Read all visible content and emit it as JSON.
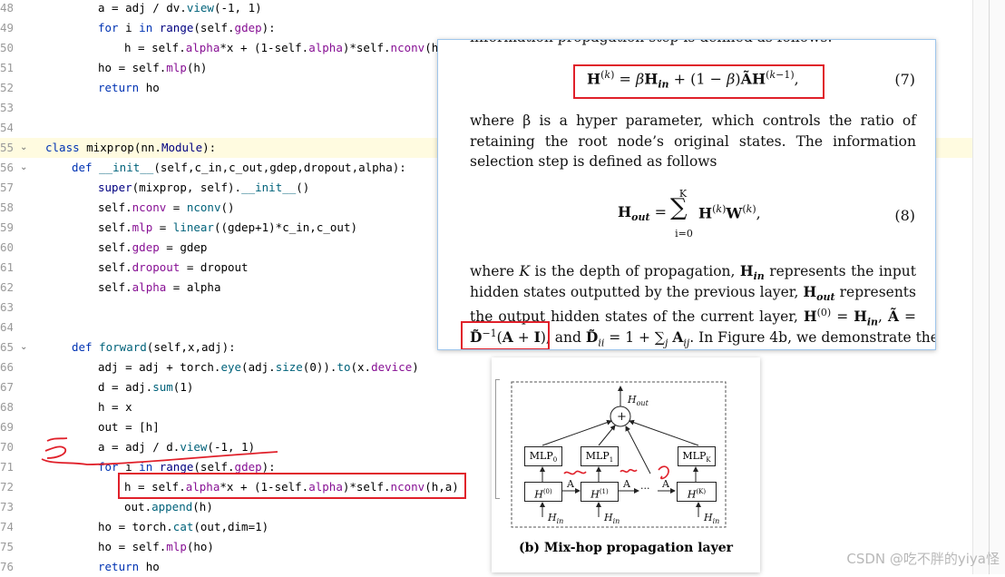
{
  "editor": {
    "lines": [
      {
        "num": "48",
        "fold": "",
        "indent": 108,
        "segs": [
          [
            "a = adj / dv.",
            ""
          ],
          [
            "view",
            "fn"
          ],
          [
            "(-1, 1)",
            ""
          ]
        ]
      },
      {
        "num": "49",
        "fold": "",
        "indent": 108,
        "segs": [
          [
            "for ",
            "kw"
          ],
          [
            "i ",
            ""
          ],
          [
            "in ",
            "kw"
          ],
          [
            "range",
            "bi"
          ],
          [
            "(self.",
            ""
          ],
          [
            "gdep",
            "at"
          ],
          [
            "):",
            ""
          ]
        ]
      },
      {
        "num": "50",
        "fold": "",
        "indent": 137,
        "segs": [
          [
            "h = self.",
            ""
          ],
          [
            "alpha",
            "at"
          ],
          [
            "*x + (1-self.",
            ""
          ],
          [
            "alpha",
            "at"
          ],
          [
            ")*self.",
            ""
          ],
          [
            "nconv",
            "at"
          ],
          [
            "(h,a",
            ""
          ]
        ]
      },
      {
        "num": "51",
        "fold": "",
        "indent": 108,
        "segs": [
          [
            "ho = self.",
            ""
          ],
          [
            "mlp",
            "at"
          ],
          [
            "(h)",
            ""
          ]
        ]
      },
      {
        "num": "52",
        "fold": "",
        "indent": 108,
        "segs": [
          [
            "return ",
            "kw"
          ],
          [
            "ho",
            ""
          ]
        ]
      },
      {
        "num": "53",
        "fold": "",
        "indent": 0,
        "segs": []
      },
      {
        "num": "54",
        "fold": "",
        "indent": 0,
        "segs": []
      },
      {
        "num": "55",
        "fold": "v",
        "indent": 50,
        "hl": true,
        "segs": [
          [
            "class ",
            "kw"
          ],
          [
            "mixprop(nn.",
            ""
          ],
          [
            "Module",
            "bi"
          ],
          [
            "):",
            ""
          ]
        ]
      },
      {
        "num": "56",
        "fold": "v",
        "indent": 79,
        "segs": [
          [
            "def ",
            "kw"
          ],
          [
            "__init__",
            "fn"
          ],
          [
            "(self,c_in,c_out,gdep,dropout,alpha):",
            ""
          ]
        ]
      },
      {
        "num": "57",
        "fold": "",
        "indent": 108,
        "segs": [
          [
            "super",
            "bi"
          ],
          [
            "(mixprop, self).",
            ""
          ],
          [
            "__init__",
            "fn"
          ],
          [
            "()",
            ""
          ]
        ]
      },
      {
        "num": "58",
        "fold": "",
        "indent": 108,
        "segs": [
          [
            "self.",
            ""
          ],
          [
            "nconv",
            "at"
          ],
          [
            " = ",
            ""
          ],
          [
            "nconv",
            "fn"
          ],
          [
            "()",
            ""
          ]
        ]
      },
      {
        "num": "59",
        "fold": "",
        "indent": 108,
        "segs": [
          [
            "self.",
            ""
          ],
          [
            "mlp",
            "at"
          ],
          [
            " = ",
            ""
          ],
          [
            "linear",
            "fn"
          ],
          [
            "((gdep+1)*c_in,c_out)",
            ""
          ]
        ]
      },
      {
        "num": "60",
        "fold": "",
        "indent": 108,
        "segs": [
          [
            "self.",
            ""
          ],
          [
            "gdep",
            "at"
          ],
          [
            " = gdep",
            ""
          ]
        ]
      },
      {
        "num": "61",
        "fold": "",
        "indent": 108,
        "segs": [
          [
            "self.",
            ""
          ],
          [
            "dropout",
            "at"
          ],
          [
            " = dropout",
            ""
          ]
        ]
      },
      {
        "num": "62",
        "fold": "",
        "indent": 108,
        "segs": [
          [
            "self.",
            ""
          ],
          [
            "alpha",
            "at"
          ],
          [
            " = alpha",
            ""
          ]
        ]
      },
      {
        "num": "63",
        "fold": "",
        "indent": 0,
        "segs": []
      },
      {
        "num": "64",
        "fold": "",
        "indent": 0,
        "segs": []
      },
      {
        "num": "65",
        "fold": "v",
        "indent": 79,
        "segs": [
          [
            "def ",
            "kw"
          ],
          [
            "forward",
            "fn"
          ],
          [
            "(self,x,adj):",
            ""
          ]
        ]
      },
      {
        "num": "66",
        "fold": "",
        "indent": 108,
        "segs": [
          [
            "adj = adj + torch.",
            ""
          ],
          [
            "eye",
            "fn"
          ],
          [
            "(adj.",
            ""
          ],
          [
            "size",
            "fn"
          ],
          [
            "(0)).",
            ""
          ],
          [
            "to",
            "fn"
          ],
          [
            "(x.",
            ""
          ],
          [
            "device",
            "at"
          ],
          [
            ")",
            ""
          ]
        ]
      },
      {
        "num": "67",
        "fold": "",
        "indent": 108,
        "segs": [
          [
            "d = adj.",
            ""
          ],
          [
            "sum",
            "fn"
          ],
          [
            "(1)",
            ""
          ]
        ]
      },
      {
        "num": "68",
        "fold": "",
        "indent": 108,
        "segs": [
          [
            "h = x",
            ""
          ]
        ]
      },
      {
        "num": "69",
        "fold": "",
        "indent": 108,
        "segs": [
          [
            "out = [h]",
            ""
          ]
        ]
      },
      {
        "num": "70",
        "fold": "",
        "indent": 108,
        "segs": [
          [
            "a = adj / d.",
            ""
          ],
          [
            "view",
            "fn"
          ],
          [
            "(-1, 1)",
            ""
          ]
        ]
      },
      {
        "num": "71",
        "fold": "",
        "indent": 108,
        "segs": [
          [
            "for ",
            "kw"
          ],
          [
            "i ",
            ""
          ],
          [
            "in ",
            "kw"
          ],
          [
            "range",
            "bi"
          ],
          [
            "(self.",
            ""
          ],
          [
            "gdep",
            "at"
          ],
          [
            "):",
            ""
          ]
        ]
      },
      {
        "num": "72",
        "fold": "",
        "indent": 137,
        "segs": [
          [
            "h = self.",
            ""
          ],
          [
            "alpha",
            "at"
          ],
          [
            "*x + (1-self.",
            ""
          ],
          [
            "alpha",
            "at"
          ],
          [
            ")*self.",
            ""
          ],
          [
            "nconv",
            "at"
          ],
          [
            "(h,a)",
            ""
          ]
        ]
      },
      {
        "num": "73",
        "fold": "",
        "indent": 137,
        "segs": [
          [
            "out.",
            ""
          ],
          [
            "append",
            "fn"
          ],
          [
            "(h)",
            ""
          ]
        ]
      },
      {
        "num": "74",
        "fold": "",
        "indent": 108,
        "segs": [
          [
            "ho = torch.",
            ""
          ],
          [
            "cat",
            "fn"
          ],
          [
            "(out,dim=1)",
            ""
          ]
        ]
      },
      {
        "num": "75",
        "fold": "",
        "indent": 108,
        "segs": [
          [
            "ho = self.",
            ""
          ],
          [
            "mlp",
            "at"
          ],
          [
            "(ho)",
            ""
          ]
        ]
      },
      {
        "num": "76",
        "fold": "",
        "indent": 108,
        "segs": [
          [
            "return ",
            "kw"
          ],
          [
            "ho",
            ""
          ]
        ]
      }
    ]
  },
  "paper": {
    "cut_top": "information propagation step is defined as follows:",
    "eq7": "H(k) = βHin + (1 − β)ÃH(k−1),",
    "eq7_no": "(7)",
    "para1": "where β is a hyper parameter, which controls the ratio of retaining the root node’s original states. The information selection step is defined as follows",
    "eq8_lhs": "Hout =",
    "eq8_sum_top": "K",
    "eq8_sum_bottom": "i=0",
    "eq8_rhs": "H(k)W(k),",
    "eq8_no": "(8)",
    "para2_l1": "where K is the depth of propagation, Hin represents the input",
    "para2_l2": "hidden states outputted by the previous layer, Hout represents",
    "para2_l3": "the output hidden states of the current layer, H(0) = Hin, Ã =",
    "para2_l4a": "D̃⁻¹(A + I),",
    "para2_l4b": " and D̃ii = 1 + ∑j Aij. In Figure 4b, we demonstrate the"
  },
  "figure": {
    "h_out": "Hout",
    "plus": "+",
    "mlp0": "MLP0",
    "mlp1": "MLP1",
    "mlpk": "MLPK",
    "h0": "H(0)",
    "h1": "H(1)",
    "hk": "H(K)",
    "a_label": "A",
    "dots": "···",
    "h_in": "Hin",
    "caption": "(b) Mix-hop propagation layer"
  },
  "watermark": "CSDN @吃不胖的yiya怪",
  "colors": {
    "annotation_red": "#e0202a",
    "line_highlight": "#fffbe0"
  }
}
